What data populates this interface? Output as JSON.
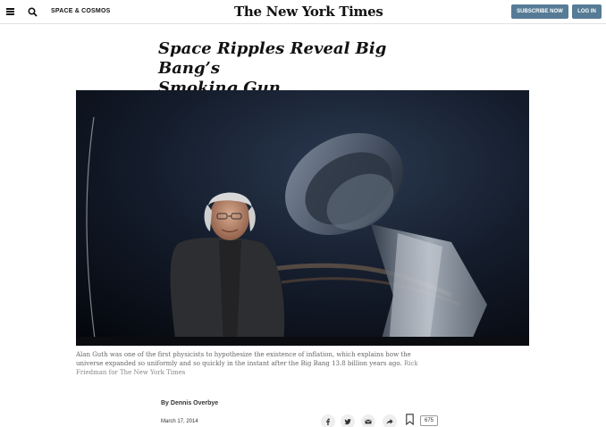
{
  "header": {
    "section": "SPACE & COSMOS",
    "logo": "The New York Times",
    "subscribe_label": "SUBSCRIBE NOW",
    "login_label": "LOG IN"
  },
  "article": {
    "headline_line1": "Space Ripples Reveal Big Bang’s",
    "headline_line2": "Smoking Gun",
    "caption_line1": "Alan Guth was one of the first physicists to hypothesize the existence of inflation, which explains how the",
    "caption_line2": "universe expanded so uniformly and so quickly in the instant after the Big Bang 13.8 billion years ago.",
    "credit_part1": "Rick",
    "credit_part2": "Friedman for The New York Times",
    "byline": "By Dennis Overbye",
    "date": "March 17, 2014",
    "comments_count": "675"
  },
  "icons": [
    "menu-icon",
    "search-icon",
    "facebook-icon",
    "twitter-icon",
    "email-icon",
    "share-icon",
    "bookmark-icon",
    "comments-icon"
  ],
  "colors": {
    "button": "#567b95",
    "text": "#121212",
    "caption": "#666666"
  }
}
